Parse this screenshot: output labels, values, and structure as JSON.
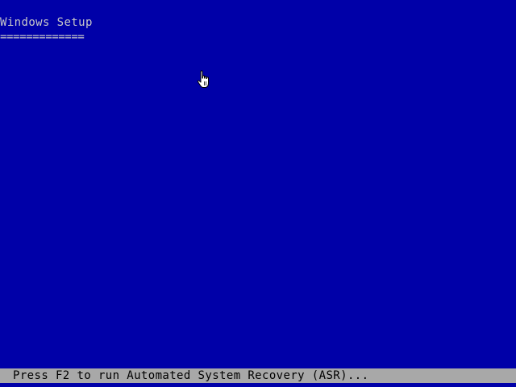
{
  "screen": {
    "background": "#0000a8",
    "text_color": "#c8c8c8"
  },
  "header": {
    "title": "Windows Setup",
    "underline": "============="
  },
  "status_bar": {
    "background": "#a8a8a8",
    "text": "Press F2 to run Automated System Recovery (ASR)..."
  },
  "cursor": {
    "icon": "hand-pointer-icon"
  }
}
